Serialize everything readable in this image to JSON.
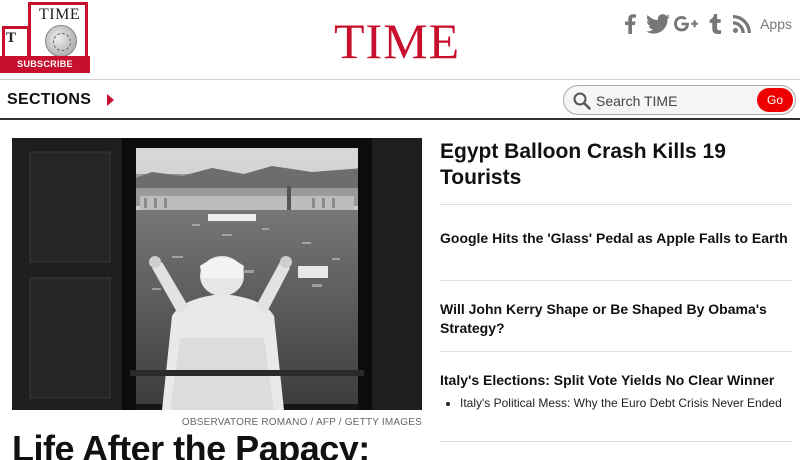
{
  "header": {
    "logo": "TIME",
    "cover_title": "TIME",
    "cover_back_letter": "T",
    "subscribe_label": "SUBSCRIBE",
    "social": {
      "icons": [
        "facebook-icon",
        "twitter-icon",
        "google-plus-icon",
        "tumblr-icon",
        "rss-icon"
      ],
      "apps_label": "Apps"
    }
  },
  "nav": {
    "sections_label": "SECTIONS",
    "search_placeholder": "Search TIME",
    "go_label": "Go"
  },
  "lead": {
    "photo_credit": "OBSERVATORE ROMANO / AFP / GETTY IMAGES",
    "headline": "Life After the Papacy:"
  },
  "stories": [
    {
      "headline": "Egypt Balloon Crash Kills 19 Tourists"
    },
    {
      "headline": "Google Hits the 'Glass' Pedal as Apple Falls to Earth"
    },
    {
      "headline": "Will John Kerry Shape or Be Shaped By Obama's Strategy?"
    },
    {
      "headline": "Italy's Elections: Split Vote Yields No Clear Winner",
      "sub_items": [
        "Italy's Political Mess: Why the Euro Debt Crisis Never Ended"
      ]
    }
  ],
  "colors": {
    "brand_red": "#c8102e",
    "go_red": "#e00000",
    "icon_gray": "#777777"
  }
}
